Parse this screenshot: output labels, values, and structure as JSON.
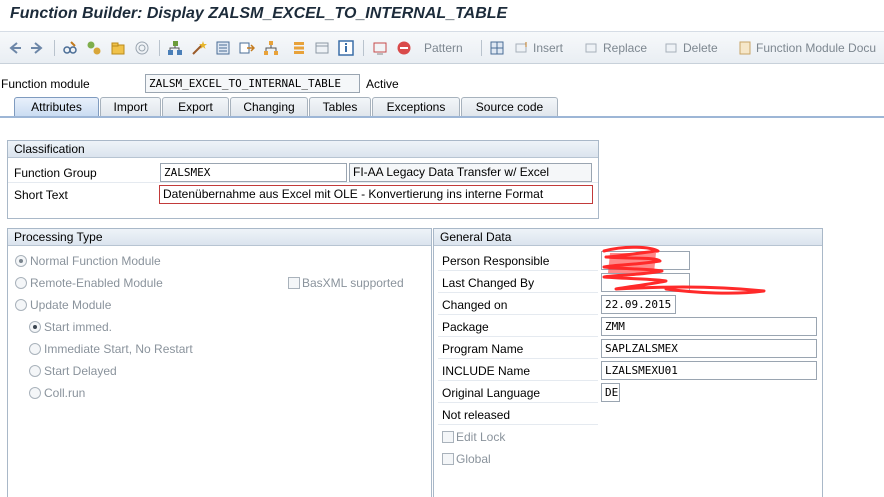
{
  "window": {
    "title": "Function Builder: Display ZALSM_EXCEL_TO_INTERNAL_TABLE"
  },
  "toolbar": {
    "pattern_label": "Pattern",
    "insert_label": "Insert",
    "replace_label": "Replace",
    "delete_label": "Delete",
    "function_module_doc_label": "Function Module Docu"
  },
  "function_module": {
    "label": "Function module",
    "value": "ZALSM_EXCEL_TO_INTERNAL_TABLE",
    "status": "Active"
  },
  "tabs": [
    {
      "label": "Attributes",
      "active": true
    },
    {
      "label": "Import"
    },
    {
      "label": "Export"
    },
    {
      "label": "Changing"
    },
    {
      "label": "Tables"
    },
    {
      "label": "Exceptions"
    },
    {
      "label": "Source code"
    }
  ],
  "classification": {
    "title": "Classification",
    "function_group_label": "Function Group",
    "function_group_value": "ZALSMEX",
    "function_group_desc": "FI-AA Legacy Data Transfer w/ Excel",
    "short_text_label": "Short Text",
    "short_text_value": "Datenübernahme aus Excel mit OLE - Konvertierung ins interne Format"
  },
  "processing_type": {
    "title": "Processing Type",
    "normal": "Normal Function Module",
    "remote": "Remote-Enabled Module",
    "basxml": "BasXML supported",
    "update": "Update Module",
    "start_immed": "Start immed.",
    "immediate_no_restart": "Immediate Start, No Restart",
    "start_delayed": "Start Delayed",
    "coll_run": "Coll.run"
  },
  "general_data": {
    "title": "General Data",
    "person_responsible_label": "Person Responsible",
    "last_changed_by_label": "Last Changed By",
    "changed_on_label": "Changed on",
    "changed_on_value": "22.09.2015",
    "package_label": "Package",
    "package_value": "ZMM",
    "program_name_label": "Program Name",
    "program_name_value": "SAPLZALSMEX",
    "include_name_label": "INCLUDE Name",
    "include_name_value": "LZALSMEXU01",
    "original_language_label": "Original Language",
    "original_language_value": "DE",
    "release_status": "Not released",
    "edit_lock_label": "Edit Lock",
    "global_label": "Global"
  }
}
